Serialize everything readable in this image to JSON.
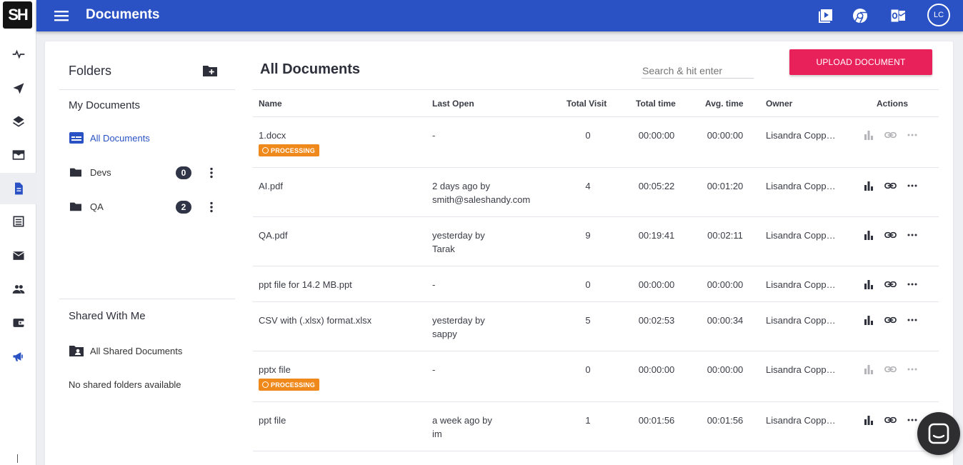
{
  "app": {
    "logo_text": "SH",
    "title": "Documents",
    "user_initials": "LC",
    "accent": "#2a52c4",
    "cta_color": "#e8215a"
  },
  "rail": {
    "icons": [
      "activity-icon",
      "send-icon",
      "layers-icon",
      "inbox-icon",
      "document-icon",
      "list-icon",
      "mail-icon",
      "people-icon",
      "wallet-icon",
      "megaphone-icon"
    ],
    "active": "document-icon"
  },
  "topbar": {
    "icons": [
      "video-tutorial-icon",
      "chrome-icon",
      "outlook-icon"
    ]
  },
  "folders": {
    "title": "Folders",
    "my_documents_label": "My Documents",
    "all_documents_label": "All Documents",
    "items": [
      {
        "label": "Devs",
        "count": "0"
      },
      {
        "label": "QA",
        "count": "2"
      }
    ],
    "shared_label": "Shared With Me",
    "all_shared_label": "All Shared Documents",
    "no_shared_text": "No shared folders available"
  },
  "documents": {
    "title": "All Documents",
    "search_placeholder": "Search & hit enter",
    "upload_label": "UPLOAD DOCUMENT",
    "columns": [
      "Name",
      "Last Open",
      "Total Visit",
      "Total time",
      "Avg. time",
      "Owner",
      "Actions"
    ],
    "processing_label": "PROCESSING",
    "rows": [
      {
        "name": "1.docx",
        "last_open_1": "-",
        "last_open_2": "",
        "visits": "0",
        "total": "00:00:00",
        "avg": "00:00:00",
        "owner": "Lisandra Coppersmith",
        "processing": true
      },
      {
        "name": "AI.pdf",
        "last_open_1": "2 days ago by",
        "last_open_2": "smith@saleshandy.com",
        "visits": "4",
        "total": "00:05:22",
        "avg": "00:01:20",
        "owner": "Lisandra Coppersmith",
        "processing": false
      },
      {
        "name": "QA.pdf",
        "last_open_1": "yesterday by",
        "last_open_2": "Tarak",
        "visits": "9",
        "total": "00:19:41",
        "avg": "00:02:11",
        "owner": "Lisandra Coppersmith",
        "processing": false
      },
      {
        "name": "ppt file for 14.2 MB.ppt",
        "last_open_1": "-",
        "last_open_2": "",
        "visits": "0",
        "total": "00:00:00",
        "avg": "00:00:00",
        "owner": "Lisandra Coppersmith",
        "processing": false
      },
      {
        "name": "CSV with (.xlsx) format.xlsx",
        "last_open_1": "yesterday by",
        "last_open_2": "sappy",
        "visits": "5",
        "total": "00:02:53",
        "avg": "00:00:34",
        "owner": "Lisandra Coppersmith",
        "processing": false
      },
      {
        "name": "pptx file",
        "last_open_1": "-",
        "last_open_2": "",
        "visits": "0",
        "total": "00:00:00",
        "avg": "00:00:00",
        "owner": "Lisandra Coppersmith",
        "processing": true
      },
      {
        "name": "ppt file",
        "last_open_1": "a week ago by",
        "last_open_2": "im",
        "visits": "1",
        "total": "00:01:56",
        "avg": "00:01:56",
        "owner": "Lisandra Coppersmith",
        "processing": false
      }
    ]
  }
}
